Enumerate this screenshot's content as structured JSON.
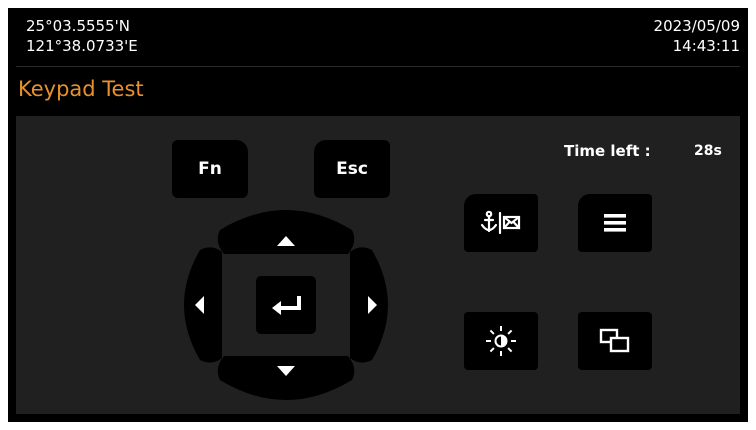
{
  "status": {
    "latitude": "25°03.5555'N",
    "longitude": "121°38.0733'E",
    "date": "2023/05/09",
    "time": "14:43:11"
  },
  "page": {
    "title": "Keypad Test"
  },
  "timer": {
    "label": "Time left :",
    "value": "28s"
  },
  "keys": {
    "fn": "Fn",
    "esc": "Esc",
    "up_icon": "triangle-up-icon",
    "down_icon": "triangle-down-icon",
    "left_icon": "triangle-left-icon",
    "right_icon": "triangle-right-icon",
    "enter_icon": "enter-arrow-icon",
    "anchor_mail_icon": "anchor-mail-icon",
    "menu_icon": "hamburger-menu-icon",
    "brightness_icon": "brightness-icon",
    "windows_icon": "overlapping-windows-icon"
  },
  "colors": {
    "title": "#e7912c",
    "panel": "#202020",
    "screen": "#000000",
    "text": "#ffffff"
  }
}
